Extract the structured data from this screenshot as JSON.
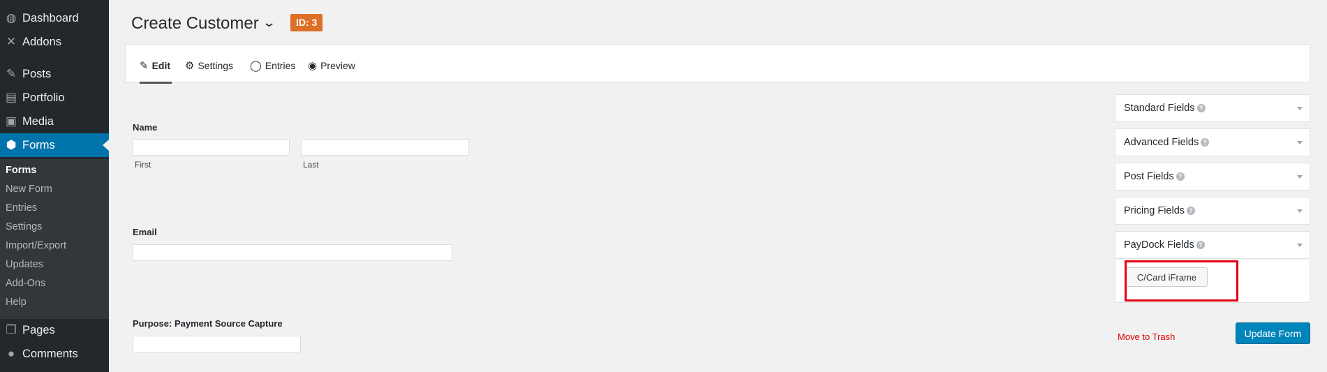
{
  "sidebar": {
    "items": [
      {
        "label": "Dashboard",
        "icon": "dashboard-icon"
      },
      {
        "label": "Addons",
        "icon": "addons-icon"
      },
      {
        "label": "Posts",
        "icon": "pin-icon"
      },
      {
        "label": "Portfolio",
        "icon": "portfolio-icon"
      },
      {
        "label": "Media",
        "icon": "media-icon"
      },
      {
        "label": "Forms",
        "icon": "forms-icon"
      },
      {
        "label": "Pages",
        "icon": "pages-icon"
      },
      {
        "label": "Comments",
        "icon": "comments-icon"
      }
    ],
    "submenu": [
      "Forms",
      "New Form",
      "Entries",
      "Settings",
      "Import/Export",
      "Updates",
      "Add-Ons",
      "Help"
    ]
  },
  "header": {
    "title": "Create Customer",
    "id_badge": "ID: 3"
  },
  "tabs": [
    {
      "label": "Edit",
      "icon": "edit-icon"
    },
    {
      "label": "Settings",
      "icon": "gears-icon"
    },
    {
      "label": "Entries",
      "icon": "comment-icon"
    },
    {
      "label": "Preview",
      "icon": "eye-icon"
    }
  ],
  "form": {
    "name": {
      "label": "Name",
      "first": "First",
      "last": "Last"
    },
    "email": {
      "label": "Email"
    },
    "purpose": {
      "label": "Purpose: Payment Source Capture"
    }
  },
  "panels": [
    {
      "title": "Standard Fields"
    },
    {
      "title": "Advanced Fields"
    },
    {
      "title": "Post Fields"
    },
    {
      "title": "Pricing Fields"
    },
    {
      "title": "PayDock Fields"
    }
  ],
  "paydock": {
    "button": "C/Card iFrame"
  },
  "actions": {
    "trash": "Move to Trash",
    "update": "Update Form"
  },
  "colors": {
    "accent": "#0073aa",
    "badge": "#dd6f27",
    "highlight": "#e3000f",
    "trash": "#dd0000"
  }
}
